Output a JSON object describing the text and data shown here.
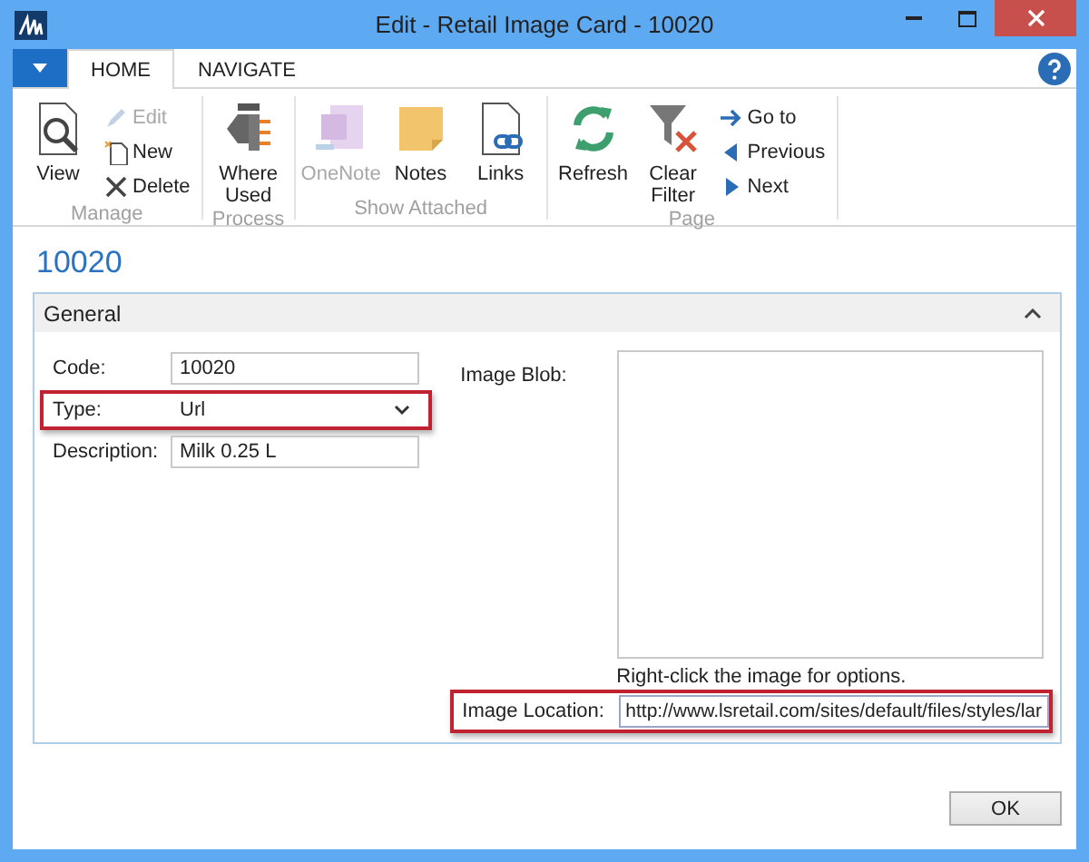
{
  "window": {
    "title": "Edit - Retail Image Card - 10020"
  },
  "ribbon_tabs": [
    {
      "label": "HOME",
      "selected": true
    },
    {
      "label": "NAVIGATE",
      "selected": false
    }
  ],
  "ribbon_groups": [
    {
      "label": "Manage",
      "items": [
        {
          "kind": "large",
          "label": "View",
          "disabled": false
        },
        {
          "kind": "small",
          "label": "Edit",
          "disabled": true
        },
        {
          "kind": "small",
          "label": "New",
          "disabled": false
        },
        {
          "kind": "small",
          "label": "Delete",
          "disabled": false
        }
      ]
    },
    {
      "label": "Process",
      "items": [
        {
          "kind": "large",
          "label": "Where Used",
          "disabled": false
        }
      ]
    },
    {
      "label": "Show Attached",
      "items": [
        {
          "kind": "large",
          "label": "OneNote",
          "disabled": true
        },
        {
          "kind": "large",
          "label": "Notes",
          "disabled": false
        },
        {
          "kind": "large",
          "label": "Links",
          "disabled": false
        }
      ]
    },
    {
      "label": "Page",
      "items": [
        {
          "kind": "large",
          "label": "Refresh",
          "disabled": false
        },
        {
          "kind": "large",
          "label": "Clear Filter",
          "disabled": false
        },
        {
          "kind": "small",
          "label": "Go to",
          "disabled": false
        },
        {
          "kind": "small",
          "label": "Previous",
          "disabled": false
        },
        {
          "kind": "small",
          "label": "Next",
          "disabled": false
        }
      ]
    }
  ],
  "heading": "10020",
  "section": {
    "title": "General",
    "expanded": true
  },
  "fields": [
    {
      "kind": "text",
      "label": "Code:",
      "value": "10020",
      "highlighted": false
    },
    {
      "kind": "select",
      "label": "Type:",
      "value": "Url",
      "highlighted": true
    },
    {
      "kind": "text",
      "label": "Description:",
      "value": "Milk 0.25 L",
      "highlighted": false
    }
  ],
  "image_blob": {
    "label": "Image Blob:",
    "hint": "Right-click the image for options."
  },
  "image_location": {
    "label": "Image Location:",
    "value": "http://www.lsretail.com/sites/default/files/styles/lar",
    "highlighted": true
  },
  "buttons": [
    "OK"
  ]
}
